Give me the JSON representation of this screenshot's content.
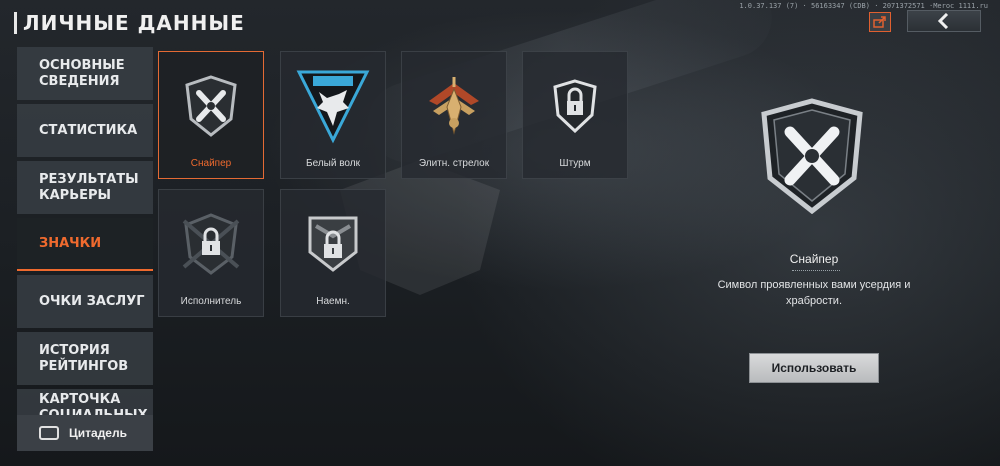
{
  "header": {
    "title": "ЛИЧНЫЕ ДАННЫЕ",
    "build_info": "1.0.37.137 (7) · 56163347 (CDB) · 2071372571 ·Meroc 1111.ru"
  },
  "sidebar": {
    "items": [
      {
        "label": "ОСНОВНЫЕ СВЕДЕНИЯ",
        "active": false
      },
      {
        "label": "СТАТИСТИКА",
        "active": false
      },
      {
        "label": "РЕЗУЛЬТАТЫ КАРЬЕРЫ",
        "active": false
      },
      {
        "label": "ЗНАЧКИ",
        "active": true
      },
      {
        "label": "ОЧКИ ЗАСЛУГ",
        "active": false
      },
      {
        "label": "ИСТОРИЯ РЕЙТИНГОВ",
        "active": false
      },
      {
        "label": "КАРТОЧКА СОЦИАЛЬНЫХ",
        "active": false
      }
    ],
    "citadel_label": "Цитадель"
  },
  "badges": [
    {
      "name": "Снайпер",
      "icon": "sniper-shield-icon",
      "selected": true,
      "locked": false
    },
    {
      "name": "Белый волк",
      "icon": "white-wolf-icon",
      "selected": false,
      "locked": false
    },
    {
      "name": "Элитн. стрелок",
      "icon": "elite-shooter-icon",
      "selected": false,
      "locked": false
    },
    {
      "name": "Штурм",
      "icon": "assault-locked-icon",
      "selected": false,
      "locked": true
    },
    {
      "name": "Исполнитель",
      "icon": "executor-locked-icon",
      "selected": false,
      "locked": true
    },
    {
      "name": "Наемн.",
      "icon": "mercenary-locked-icon",
      "selected": false,
      "locked": true
    }
  ],
  "detail": {
    "name": "Снайпер",
    "description": "Символ проявленных вами усердия и храбрости.",
    "use_label": "Использовать"
  },
  "colors": {
    "accent": "#ef6a2e",
    "panel": "#3a4046",
    "text": "#e8eaec"
  }
}
